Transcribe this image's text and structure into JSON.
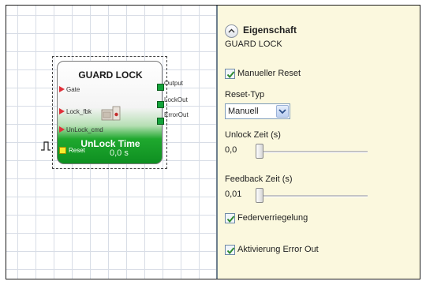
{
  "block": {
    "title": "GUARD LOCK",
    "inputs": [
      "Gate",
      "Lock_fbk",
      "UnLock_cmd"
    ],
    "reset_label": "Reset",
    "outputs": [
      "Output",
      "LockOut",
      "ErrorOut"
    ],
    "mode_title": "UnLock Time",
    "mode_value": "0,0 s"
  },
  "panel": {
    "header": "Eigenschaft",
    "block_name": "GUARD LOCK",
    "manual_reset": {
      "label": "Manueller Reset",
      "checked": true
    },
    "reset_type": {
      "label": "Reset-Typ",
      "value": "Manuell"
    },
    "unlock_time": {
      "label": "Unlock Zeit (s)",
      "value": "0,0",
      "slider_fraction": 0.0
    },
    "feedback_time": {
      "label": "Feedback Zeit (s)",
      "value": "0,01",
      "slider_fraction": 0.0
    },
    "spring_lock": {
      "label": "Federverriegelung",
      "checked": true
    },
    "error_out": {
      "label": "Aktivierung Error Out",
      "checked": true
    }
  },
  "colors": {
    "panel_bg": "#fbf8de",
    "block_green": "#1fa82e",
    "input_pin": "#e0303a",
    "output_pin": "#13a33a",
    "reset_pin": "#f7ec2e",
    "grid": "#d8dde6"
  },
  "icons": [
    "collapse-up-icon",
    "checkmark-icon",
    "dropdown-chevron-icon",
    "pulse-signal-icon",
    "guard-lock-device-icon"
  ]
}
